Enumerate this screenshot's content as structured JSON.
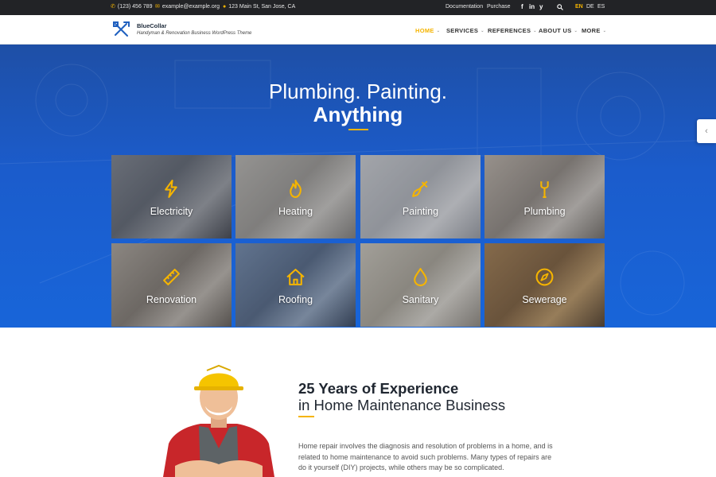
{
  "topbar": {
    "phone": "(123) 456 789",
    "email": "example@example.org",
    "address": "123 Main St, San Jose, CA",
    "documentation": "Documentation",
    "purchase": "Purchase",
    "social": [
      "f",
      "in",
      "y"
    ],
    "languages": [
      "EN",
      "DE",
      "ES"
    ],
    "active_language": "EN"
  },
  "header": {
    "brand": "BlueCollar",
    "tagline": "Handyman & Renovation Business WordPress Theme",
    "nav": [
      {
        "label": "HOME",
        "active": true
      },
      {
        "label": "SERVICES",
        "active": false
      },
      {
        "label": "REFERENCES",
        "active": false
      },
      {
        "label": "ABOUT US",
        "active": false
      },
      {
        "label": "MORE",
        "active": false
      }
    ],
    "caret": "⌄"
  },
  "hero": {
    "line1": "Plumbing. Painting.",
    "line2": "Anything"
  },
  "services": [
    {
      "label": "Electricity",
      "icon": "lightning-icon"
    },
    {
      "label": "Heating",
      "icon": "flame-icon"
    },
    {
      "label": "Painting",
      "icon": "paintbrush-icon"
    },
    {
      "label": "Plumbing",
      "icon": "wrench-icon"
    },
    {
      "label": "Renovation",
      "icon": "ruler-icon"
    },
    {
      "label": "Roofing",
      "icon": "house-icon"
    },
    {
      "label": "Sanitary",
      "icon": "droplet-icon"
    },
    {
      "label": "Sewerage",
      "icon": "compass-icon"
    }
  ],
  "about": {
    "title": "25 Years of Experience",
    "subtitle": "in Home Maintenance Business",
    "body": "Home repair involves the diagnosis and resolution of problems in a home, and is related to home maintenance to avoid such problems. Many types of repairs are do it yourself (DIY) projects, while others may be so complicated."
  },
  "colors": {
    "accent": "#f5b400",
    "topbar": "#222326",
    "hero": "#1b5ccc"
  }
}
